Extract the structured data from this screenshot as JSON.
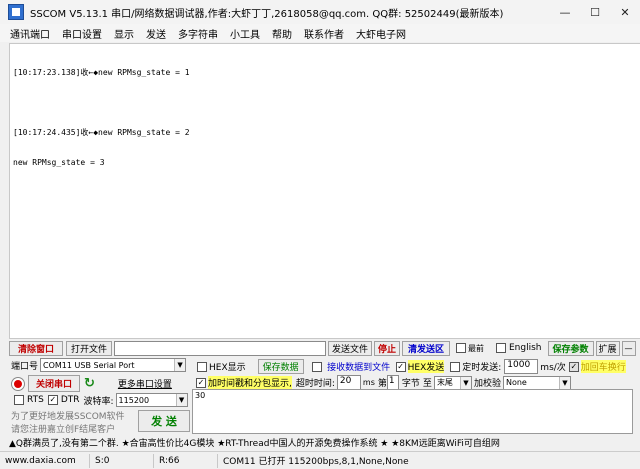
{
  "title": "SSCOM V5.13.1 串口/网络数据调试器,作者:大虾丁丁,2618058@qq.com. QQ群: 52502449(最新版本)",
  "menu": [
    "通讯端口",
    "串口设置",
    "显示",
    "发送",
    "多字符串",
    "小工具",
    "帮助",
    "联系作者",
    "大虾电子网"
  ],
  "receive_lines": [
    "[10:17:23.138]收←◆new RPMsg_state = 1",
    "",
    "[10:17:24.435]收←◆new RPMsg_state = 2",
    "new RPMsg_state = 3"
  ],
  "toolbar1": {
    "clear_window": "清除窗口",
    "open_file": "打开文件",
    "file_path": "",
    "send_file": "发送文件",
    "stop": "停止",
    "clear_send": "清发送区",
    "topmost": "最前",
    "english": "English",
    "save_params": "保存参数",
    "expand": "扩展",
    "minus": "—"
  },
  "row2": {
    "port_label": "端口号",
    "port_value": "COM11 USB Serial Port",
    "hex_display": "HEX显示",
    "save_data": "保存数据",
    "recv_to_file": "接收数据到文件",
    "hex_send": "HEX发送",
    "timed_send": "定时发送:",
    "interval": "1000",
    "interval_unit": "ms/次",
    "add_crlf": "加回车换行"
  },
  "row3": {
    "close_port": "关闭串口",
    "more_settings": "更多串口设置",
    "timestamp": "加时间戳和分包显示,",
    "timeout_label": "超时时间:",
    "timeout_value": "20",
    "timeout_unit": "ms",
    "nth": "第",
    "byte_index": "1",
    "byte_unit": "字节",
    "to": "至",
    "end": "末尾",
    "checksum_label": "加校验",
    "checksum_value": "None"
  },
  "row4": {
    "rts": "RTS",
    "dtr": "DTR",
    "baud_label": "波特率:",
    "baud_value": "115200"
  },
  "promo": {
    "line1": "为了更好地发展SSCOM软件",
    "line2": "请您注册嘉立创F结尾客户"
  },
  "send_button": "发 送",
  "send_text": "30",
  "ad_text": "▲Q群满员了,没有第二个群. ★合宙高性价比4G模块 ★RT-Thread中国人的开源免费操作系统 ★ ★8KM远距离WiFi可自组网",
  "status": {
    "site": "www.daxia.com",
    "sent": "S:0",
    "received": "R:66",
    "port_status": "COM11 已打开  115200bps,8,1,None,None"
  }
}
